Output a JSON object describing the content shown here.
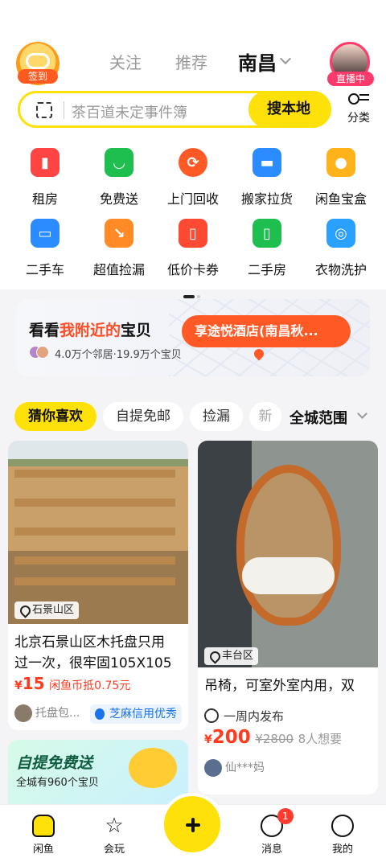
{
  "header": {
    "signin_label": "签到",
    "tabs": [
      {
        "label": "关注"
      },
      {
        "label": "推荐"
      },
      {
        "label": "南昌"
      }
    ],
    "live_label": "直播中"
  },
  "search": {
    "placeholder": "茶百道未定事件簿",
    "button": "搜本地",
    "category_label": "分类"
  },
  "services": [
    {
      "label": "租房",
      "icon": "building-icon",
      "color": "#ff4444"
    },
    {
      "label": "免费送",
      "icon": "gift-bag-icon",
      "color": "#1fbf4f"
    },
    {
      "label": "上门回收",
      "icon": "recycle-icon",
      "color": "#ff5a26"
    },
    {
      "label": "搬家拉货",
      "icon": "truck-icon",
      "color": "#2a8cff"
    },
    {
      "label": "闲鱼宝盒",
      "icon": "box-icon",
      "color": "#ffb21a"
    },
    {
      "label": "二手车",
      "icon": "car-icon",
      "color": "#2a8cff"
    },
    {
      "label": "超值捡漏",
      "icon": "bag-arrow-icon",
      "color": "#ff8a26"
    },
    {
      "label": "低价卡券",
      "icon": "coupon-icon",
      "color": "#ff4a33"
    },
    {
      "label": "二手房",
      "icon": "door-icon",
      "color": "#1fbf4f"
    },
    {
      "label": "衣物洗护",
      "icon": "washer-icon",
      "color": "#2aa0ff"
    }
  ],
  "nearby": {
    "title_prefix": "看看",
    "title_highlight": "我附近的",
    "title_suffix": "宝贝",
    "stats": "4.0万个邻居·19.9万个宝贝",
    "promo_pill": "享途悦酒店(南昌秋..."
  },
  "filters": {
    "chips": [
      "猜你喜欢",
      "自提免邮",
      "捡漏",
      "新"
    ],
    "scope": "全城范围"
  },
  "feed": {
    "item1": {
      "location": "石景山区",
      "title_line1": "北京石景山区木托盘只用",
      "title_line2": "过一次，很牢固105X105",
      "currency": "¥",
      "price": "15",
      "note": "闲鱼币抵0.75元",
      "seller": "托盘包...",
      "credit": "芝麻信用优秀"
    },
    "item2": {
      "location": "丰台区",
      "title": "吊椅，可室外室内用，双",
      "publish": "一周内发布",
      "currency": "¥",
      "price": "200",
      "orig_price": "¥2800",
      "want": "8人想要",
      "seller": "仙***妈"
    },
    "promo": {
      "title": "自提免费送",
      "sub": "全城有960个宝贝"
    }
  },
  "nav": {
    "items": [
      {
        "label": "闲鱼"
      },
      {
        "label": "会玩"
      },
      {
        "label": "消息"
      },
      {
        "label": "我的"
      }
    ],
    "message_badge": "1"
  }
}
